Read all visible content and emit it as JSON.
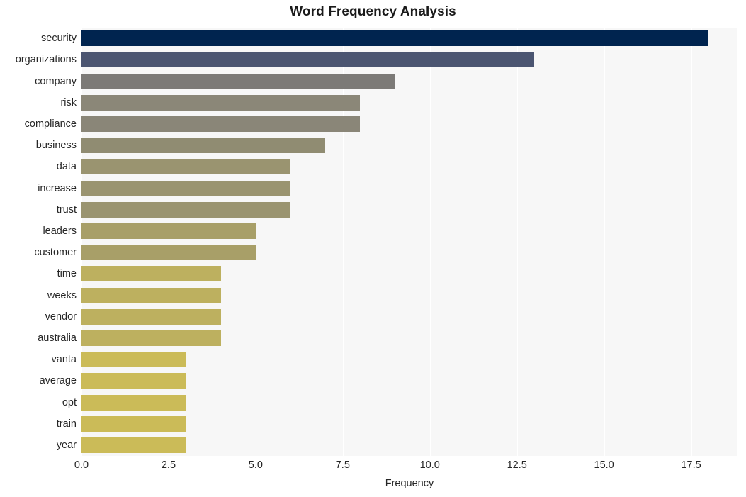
{
  "chart_data": {
    "type": "bar",
    "orientation": "horizontal",
    "title": "Word Frequency Analysis",
    "xlabel": "Frequency",
    "ylabel": "",
    "categories": [
      "security",
      "organizations",
      "company",
      "risk",
      "compliance",
      "business",
      "data",
      "increase",
      "trust",
      "leaders",
      "customer",
      "time",
      "weeks",
      "vendor",
      "australia",
      "vanta",
      "average",
      "opt",
      "train",
      "year"
    ],
    "values": [
      18,
      13,
      9,
      8,
      8,
      7,
      6,
      6,
      6,
      5,
      5,
      4,
      4,
      4,
      4,
      3,
      3,
      3,
      3,
      3
    ],
    "bar_colors": [
      "#00244f",
      "#4b5571",
      "#7c7a77",
      "#8b8778",
      "#8a8678",
      "#908c72",
      "#9a9470",
      "#9a9470",
      "#9a9470",
      "#a89f68",
      "#a89f68",
      "#bdb05f",
      "#bdb05f",
      "#bdb05f",
      "#bdb05f",
      "#cbbb58",
      "#cbbb58",
      "#cbbb58",
      "#cbbb58",
      "#cbbb58"
    ],
    "xlim": [
      0,
      18.83
    ],
    "ylim_count": 20,
    "xticks": [
      0.0,
      2.5,
      5.0,
      7.5,
      10.0,
      12.5,
      15.0,
      17.5
    ],
    "xtick_labels": [
      "0.0",
      "2.5",
      "5.0",
      "7.5",
      "10.0",
      "12.5",
      "15.0",
      "17.5"
    ],
    "grid": true,
    "grid_axis": "x",
    "grid_color": "#ffffff",
    "legend": false,
    "plot_background": "#f7f7f7",
    "figure_background": "#ffffff"
  }
}
